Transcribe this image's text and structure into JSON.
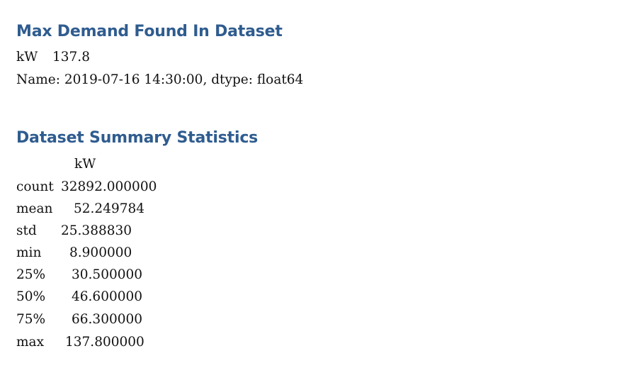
{
  "section1": {
    "title": "Max Demand Found In Dataset",
    "line1_label": "kW",
    "line1_value": "137.8",
    "line2": "Name: 2019-07-16 14:30:00, dtype: float64"
  },
  "section2": {
    "title": "Dataset Summary Statistics",
    "column_header": "kW",
    "rows": [
      {
        "label": "count",
        "value": "32892.000000"
      },
      {
        "label": "mean",
        "value": "52.249784"
      },
      {
        "label": "std",
        "value": "25.388830"
      },
      {
        "label": "min",
        "value": "8.900000"
      },
      {
        "label": "25%",
        "value": "30.500000"
      },
      {
        "label": "50%",
        "value": "46.600000"
      },
      {
        "label": "75%",
        "value": "66.300000"
      },
      {
        "label": "max",
        "value": "137.800000"
      }
    ]
  }
}
